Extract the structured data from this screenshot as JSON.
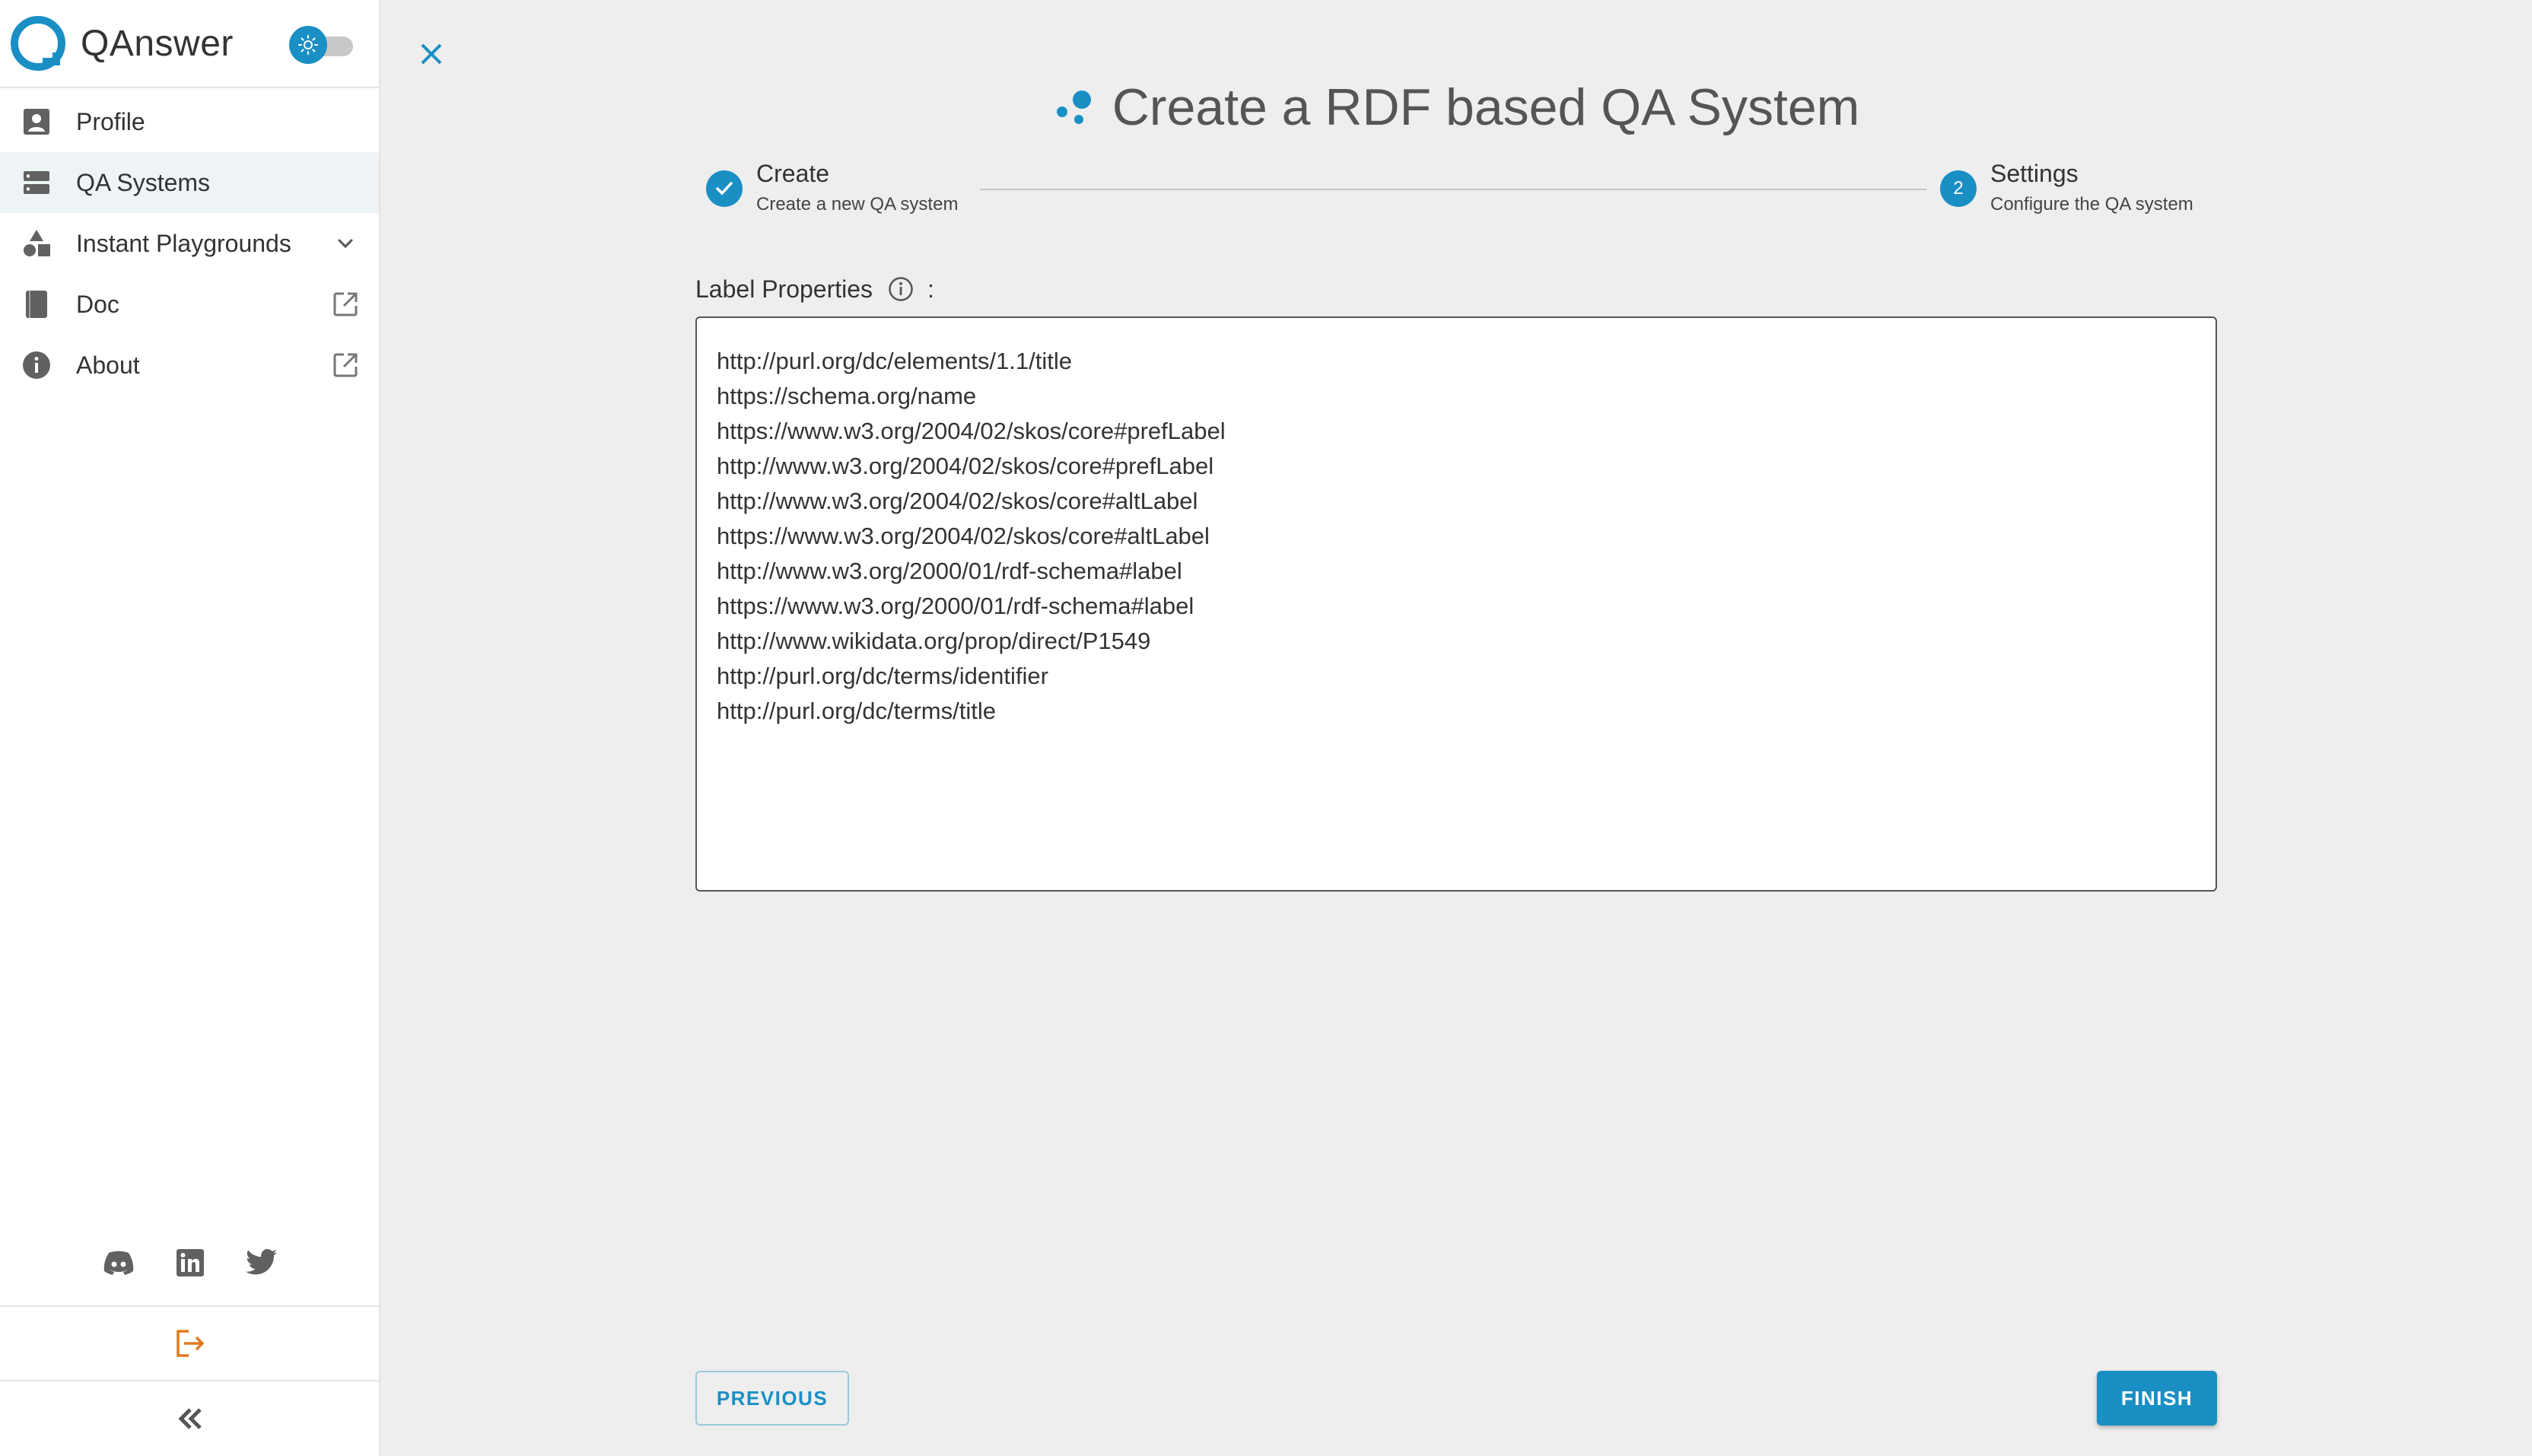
{
  "app": {
    "name": "QAnswer",
    "accent_color": "#1a8fc4",
    "logout_color": "#e07a1f"
  },
  "sidebar": {
    "items": [
      {
        "label": "Profile",
        "icon": "profile-icon"
      },
      {
        "label": "QA Systems",
        "icon": "server-icon",
        "active": true
      },
      {
        "label": "Instant Playgrounds",
        "icon": "shapes-icon",
        "trail": "chevron-down-icon"
      },
      {
        "label": "Doc",
        "icon": "book-icon",
        "trail": "external-link-icon"
      },
      {
        "label": "About",
        "icon": "info-icon",
        "trail": "external-link-icon"
      }
    ],
    "social": [
      "discord-icon",
      "linkedin-icon",
      "twitter-icon"
    ],
    "logout_icon": "logout-icon",
    "collapse_icon": "double-chevron-left-icon"
  },
  "main": {
    "title": "Create a RDF based QA System",
    "close_icon": "close-icon",
    "steps": [
      {
        "title": "Create",
        "subtitle": "Create a new QA system",
        "status": "completed"
      },
      {
        "number": "2",
        "title": "Settings",
        "subtitle": "Configure the QA system",
        "status": "active"
      }
    ],
    "field": {
      "label": "Label Properties",
      "suffix": ":",
      "lines": [
        "http://purl.org/dc/elements/1.1/title",
        "https://schema.org/name",
        "https://www.w3.org/2004/02/skos/core#prefLabel",
        "http://www.w3.org/2004/02/skos/core#prefLabel",
        "http://www.w3.org/2004/02/skos/core#altLabel",
        "https://www.w3.org/2004/02/skos/core#altLabel",
        "http://www.w3.org/2000/01/rdf-schema#label",
        "https://www.w3.org/2000/01/rdf-schema#label",
        "http://www.wikidata.org/prop/direct/P1549",
        "http://purl.org/dc/terms/identifier",
        "http://purl.org/dc/terms/title"
      ]
    },
    "buttons": {
      "previous": "PREVIOUS",
      "finish": "FINISH"
    }
  }
}
